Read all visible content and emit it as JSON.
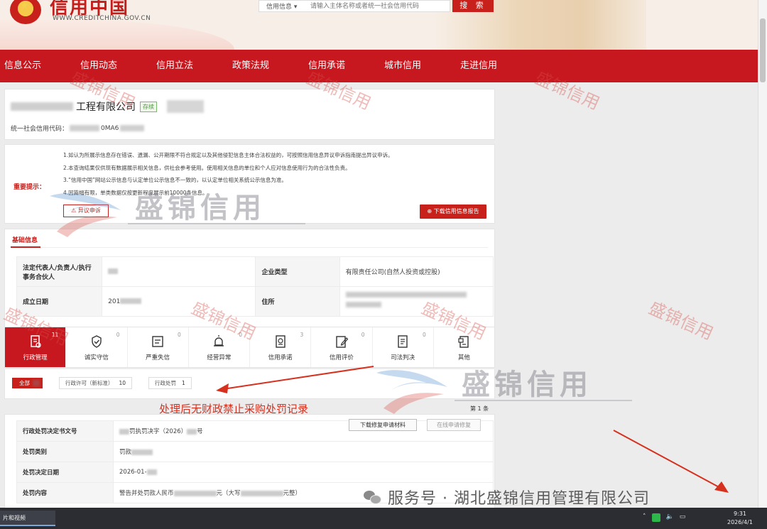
{
  "header": {
    "site_title": "信用中国",
    "site_url": "WWW.CREDITCHINA.GOV.CN",
    "search_scope": "信用信息",
    "search_placeholder": "请输入主体名称或者统一社会信用代码",
    "search_button": "搜 索"
  },
  "nav": [
    "信息公示",
    "信用动态",
    "信用立法",
    "政策法规",
    "信用承诺",
    "城市信用",
    "走进信用"
  ],
  "company": {
    "name_suffix": "工程有限公司",
    "status_tag": "存续",
    "ucc_label": "统一社会信用代码：",
    "ucc_visible": "0MA6"
  },
  "notice": {
    "label": "重要提示：",
    "items": [
      "1.如认为所展示信息存在错误、遗漏、公开期限不符合规定以及其他侵犯信息主体合法权益的，可按照信用信息异议申诉指南提出异议申诉。",
      "2.本查询结果仅供现有数据展示相关信息，供社会参考使用。使用相关信息的单位和个人应对信息使用行为的合法性负责。",
      "3.“信用中国”网站公示信息与认定单位公示信息不一致的，以认定单位相关系统公示信息为准。",
      "4.因篇幅有限，单类数据仅按更新程度展示前10000条信息。"
    ],
    "objection_button": "异议申诉",
    "download_button": "下载信用信息报告"
  },
  "basic_info": {
    "title": "基础信息",
    "rows": [
      {
        "k1": "法定代表人/负责人/执行事务合伙人",
        "k2": "企业类型",
        "v2": "有限责任公司(自然人投资或控股)"
      },
      {
        "k1": "成立日期",
        "v1_visible": "201",
        "k2": "住所"
      }
    ]
  },
  "tabs": [
    {
      "label": "行政管理",
      "count": "11",
      "icon": "admin-doc-icon"
    },
    {
      "label": "诚实守信",
      "count": "0",
      "icon": "shield-check-icon"
    },
    {
      "label": "严重失信",
      "count": "0",
      "icon": "blacklist-icon"
    },
    {
      "label": "经营异常",
      "count": "0",
      "icon": "alarm-lamp-icon"
    },
    {
      "label": "信用承诺",
      "count": "3",
      "icon": "commitment-doc-icon"
    },
    {
      "label": "信用评价",
      "count": "0",
      "icon": "evaluation-edit-icon"
    },
    {
      "label": "司法判决",
      "count": "0",
      "icon": "judgment-doc-icon"
    },
    {
      "label": "其他",
      "count": "",
      "icon": "other-doc-icon"
    }
  ],
  "filters": {
    "all_label": "全部",
    "chips": [
      {
        "label": "行政许可（新标准）",
        "count": "10"
      },
      {
        "label": "行政处罚",
        "count": "1"
      }
    ]
  },
  "annotation": "处理后无财政禁止采购处罚记录",
  "page_indicator": "第 1 条",
  "penalty": {
    "rows": [
      {
        "k": "行政处罚决定书文号",
        "v_mid": "罚执罚决字（2026）",
        "v_end": "号"
      },
      {
        "k": "处罚类别",
        "v": "罚款"
      },
      {
        "k": "处罚决定日期",
        "v": "2026-01-"
      },
      {
        "k": "处罚内容",
        "v_a": "警告并处罚款人民币",
        "v_b": "元（大写",
        "v_c": "元整）"
      }
    ],
    "repair_download_button": "下载修复申请材料",
    "online_repair_button": "在线申请修复"
  },
  "caption": "服务号 · 湖北盛锦信用管理有限公司",
  "watermark": {
    "text": "盛锦信用"
  },
  "taskbar": {
    "item": "片和视频",
    "time": "9:31",
    "date": "2026/4/1"
  },
  "colors": {
    "brand_red": "#c8181f",
    "annotation_red": "#d6301f"
  }
}
